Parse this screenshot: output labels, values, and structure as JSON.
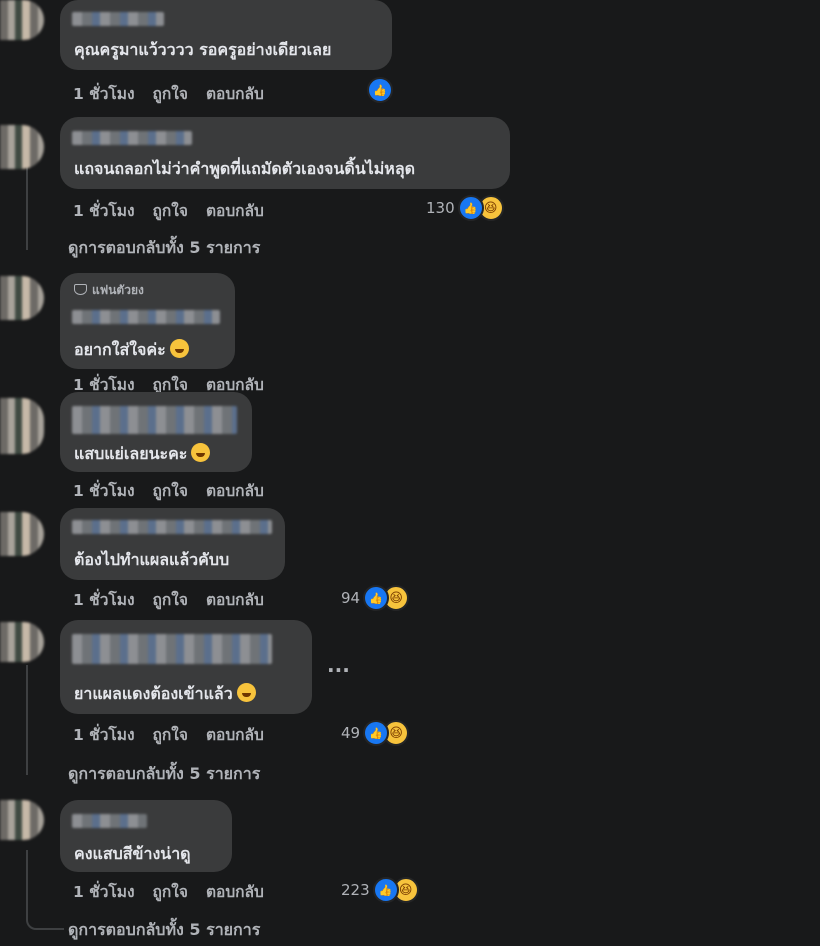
{
  "comments": [
    {
      "text": "คุณครูมาแว้วววว รอครูอย่างเดียวเลย",
      "time": "1 ชั่วโมง",
      "like": "ถูกใจ",
      "reply": "ตอบกลับ",
      "reaction_count": ""
    },
    {
      "text": "แถจนถลอกไม่ว่าคำพูดที่แถมัดตัวเองจนดิ้นไม่หลุด",
      "time": "1 ชั่วโมง",
      "like": "ถูกใจ",
      "reply": "ตอบกลับ",
      "reaction_count": "130",
      "view_replies": "ดูการตอบกลับทั้ง 5 รายการ"
    },
    {
      "badge": "แฟนตัวยง",
      "text": "อยากใส่ใจค่ะ",
      "time": "1 ชั่วโมง",
      "like": "ถูกใจ",
      "reply": "ตอบกลับ"
    },
    {
      "text": "แสบแย่เลยนะคะ",
      "time": "1 ชั่วโมง",
      "like": "ถูกใจ",
      "reply": "ตอบกลับ"
    },
    {
      "text": "ต้องไปทำแผลแล้วคับบ",
      "time": "1 ชั่วโมง",
      "like": "ถูกใจ",
      "reply": "ตอบกลับ",
      "reaction_count": "94"
    },
    {
      "text": "ยาแผลแดงต้องเข้าแล้ว",
      "time": "1 ชั่วโมง",
      "like": "ถูกใจ",
      "reply": "ตอบกลับ",
      "reaction_count": "49",
      "view_replies": "ดูการตอบกลับทั้ง 5 รายการ",
      "more": "..."
    },
    {
      "text": "คงแสบสีข้างน่าดู",
      "time": "1 ชั่วโมง",
      "like": "ถูกใจ",
      "reply": "ตอบกลับ",
      "reaction_count": "223",
      "view_replies": "ดูการตอบกลับทั้ง 5 รายการ"
    }
  ],
  "colors": {
    "background": "#18191a",
    "bubble": "#3a3b3c",
    "text": "#e4e6eb",
    "secondary": "#b0b3b8",
    "like_blue": "#1877f2",
    "haha_yellow": "#f7c33c"
  },
  "icons": {
    "like": "like-reaction-icon",
    "haha": "haha-reaction-icon",
    "badge": "diamond-badge-icon",
    "more": "more-options-icon"
  }
}
